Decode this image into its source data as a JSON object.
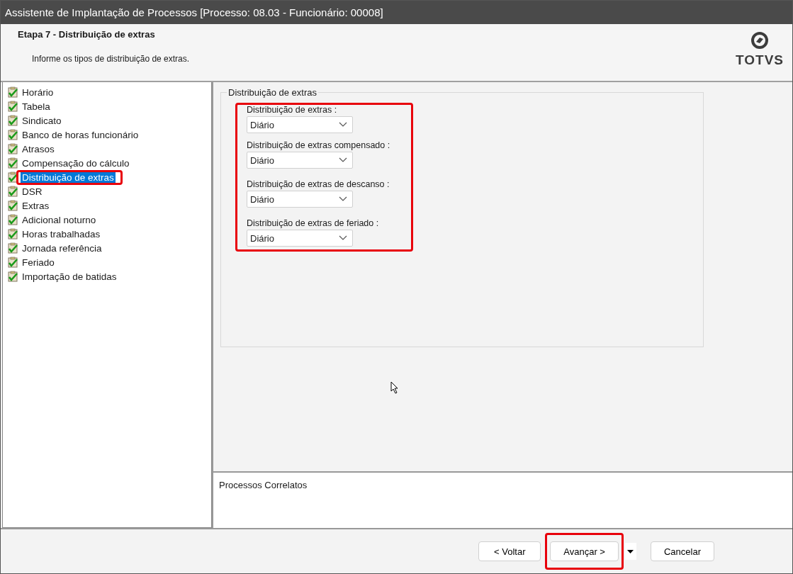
{
  "window": {
    "title": "Assistente de Implantação de Processos [Processo: 08.03 - Funcionário: 00008]"
  },
  "header": {
    "step": "Etapa 7 - Distribuição de extras",
    "instruction": "Informe os tipos de distribuição de extras.",
    "logo": "TOTVS"
  },
  "steps": [
    {
      "label": "Horário",
      "selected": false
    },
    {
      "label": "Tabela",
      "selected": false
    },
    {
      "label": "Sindicato",
      "selected": false
    },
    {
      "label": "Banco de horas funcionário",
      "selected": false
    },
    {
      "label": "Atrasos",
      "selected": false
    },
    {
      "label": "Compensação do cálculo",
      "selected": false
    },
    {
      "label": "Distribuição de extras",
      "selected": true
    },
    {
      "label": "DSR",
      "selected": false
    },
    {
      "label": "Extras",
      "selected": false
    },
    {
      "label": "Adicional noturno",
      "selected": false
    },
    {
      "label": "Horas trabalhadas",
      "selected": false
    },
    {
      "label": "Jornada referência",
      "selected": false
    },
    {
      "label": "Feriado",
      "selected": false
    },
    {
      "label": "Importação de batidas",
      "selected": false
    }
  ],
  "group": {
    "title": "Distribuição de extras",
    "fields": [
      {
        "label": "Distribuição de extras :",
        "value": "Diário"
      },
      {
        "label": "Distribuição de extras compensado :",
        "value": "Diário"
      },
      {
        "label": "Distribuição de extras de descanso :",
        "value": "Diário"
      },
      {
        "label": "Distribuição de extras de feriado :",
        "value": "Diário"
      }
    ]
  },
  "related": {
    "title": "Processos Correlatos"
  },
  "buttons": {
    "back": "< Voltar",
    "next": "Avançar >",
    "cancel": "Cancelar"
  }
}
